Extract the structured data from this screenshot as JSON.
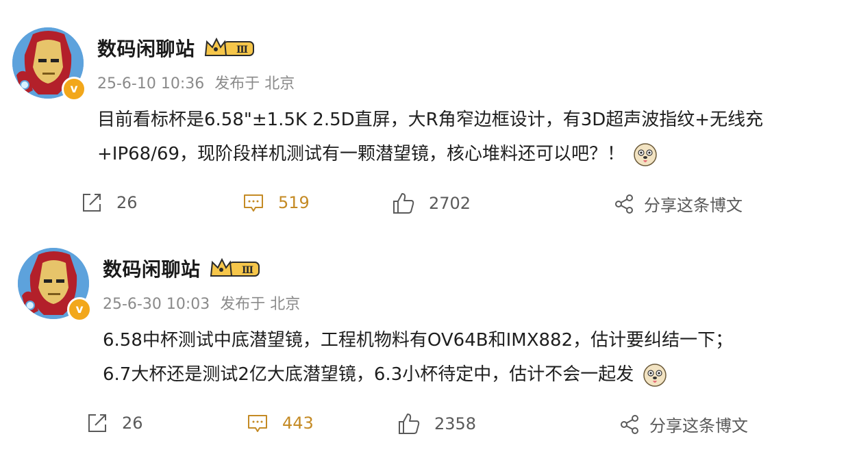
{
  "posts": [
    {
      "author": "数码闲聊站",
      "level_badge": "Ⅲ",
      "verified_badge": "v",
      "time": "25-6-10 10:36",
      "source": "发布于 北京",
      "lines": [
        "目前看标杯是6.58\"±1.5K 2.5D直屏，大R角窄边框设计，有3D超声波指纹+无线充",
        "+IP68/69，现阶段样机测试有一颗潜望镜，核心堆料还可以吧？！"
      ],
      "repost_count": "26",
      "comment_count": "519",
      "like_count": "2702",
      "share_label": "分享这条博文"
    },
    {
      "author": "数码闲聊站",
      "level_badge": "Ⅲ",
      "verified_badge": "v",
      "time": "25-6-30 10:03",
      "source": "发布于 北京",
      "lines": [
        "6.58中杯测试中底潜望镜，工程机物料有OV64B和IMX882，估计要纠结一下；",
        "6.7大杯还是测试2亿大底潜望镜，6.3小杯待定中，估计不会一起发"
      ],
      "repost_count": "26",
      "comment_count": "443",
      "like_count": "2358",
      "share_label": "分享这条博文"
    }
  ],
  "colors": {
    "accent_comment": "#c48a24",
    "meta_gray": "#8a8a8a",
    "badge_gold": "#f2a71b"
  },
  "icons": [
    "repost-icon",
    "comment-icon",
    "like-icon",
    "share-icon",
    "crown-icon",
    "verified-icon",
    "doge-emoji-icon"
  ]
}
